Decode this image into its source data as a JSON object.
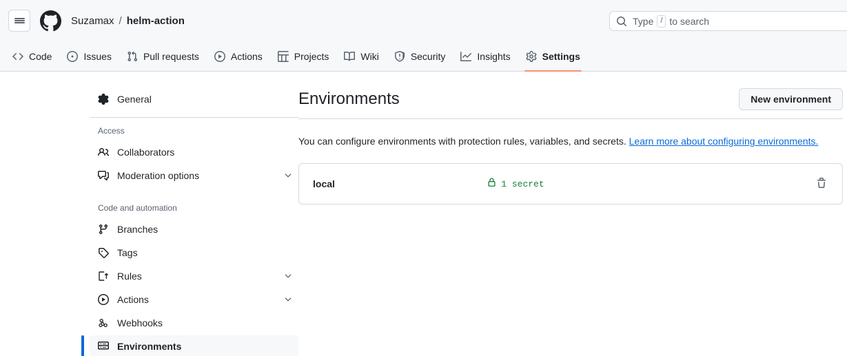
{
  "header": {
    "menu_label": "Open menu",
    "logo_name": "GitHub",
    "breadcrumb": {
      "owner": "Suzamax",
      "separator": "/",
      "repo": "helm-action"
    },
    "search": {
      "placeholder_prefix": "Type",
      "key_hint": "/",
      "placeholder_suffix": "to search"
    }
  },
  "repo_nav": {
    "tabs": [
      {
        "label": "Code",
        "icon": "code-icon",
        "active": false
      },
      {
        "label": "Issues",
        "icon": "issue-opened-icon",
        "active": false
      },
      {
        "label": "Pull requests",
        "icon": "git-pull-request-icon",
        "active": false
      },
      {
        "label": "Actions",
        "icon": "play-icon",
        "active": false
      },
      {
        "label": "Projects",
        "icon": "table-icon",
        "active": false
      },
      {
        "label": "Wiki",
        "icon": "book-icon",
        "active": false
      },
      {
        "label": "Security",
        "icon": "shield-icon",
        "active": false
      },
      {
        "label": "Insights",
        "icon": "graph-icon",
        "active": false
      },
      {
        "label": "Settings",
        "icon": "gear-icon",
        "active": true
      }
    ]
  },
  "sidebar": {
    "general": {
      "label": "General",
      "icon": "gear-icon"
    },
    "groups": [
      {
        "title": "Access",
        "items": [
          {
            "label": "Collaborators",
            "icon": "people-icon",
            "expandable": false
          },
          {
            "label": "Moderation options",
            "icon": "comment-discussion-icon",
            "expandable": true
          }
        ]
      },
      {
        "title": "Code and automation",
        "items": [
          {
            "label": "Branches",
            "icon": "git-branch-icon",
            "expandable": false
          },
          {
            "label": "Tags",
            "icon": "tag-icon",
            "expandable": false
          },
          {
            "label": "Rules",
            "icon": "rules-icon",
            "expandable": true
          },
          {
            "label": "Actions",
            "icon": "play-icon",
            "expandable": true
          },
          {
            "label": "Webhooks",
            "icon": "webhook-icon",
            "expandable": false
          },
          {
            "label": "Environments",
            "icon": "server-icon",
            "expandable": false,
            "selected": true
          }
        ]
      }
    ]
  },
  "main": {
    "title": "Environments",
    "new_button": "New environment",
    "description_text": "You can configure environments with protection rules, variables, and secrets.",
    "description_link": "Learn more about configuring environments.",
    "environments": [
      {
        "name": "local",
        "secrets_label": "1 secret",
        "lock_icon": "lock-icon",
        "delete_icon": "trash-icon"
      }
    ]
  },
  "colors": {
    "accent_underline": "#fd8c73",
    "link": "#0969da",
    "selected_bar": "#0969da",
    "success": "#1a7f37",
    "header_bg": "#f6f8fa",
    "border": "#d1d9e0"
  }
}
